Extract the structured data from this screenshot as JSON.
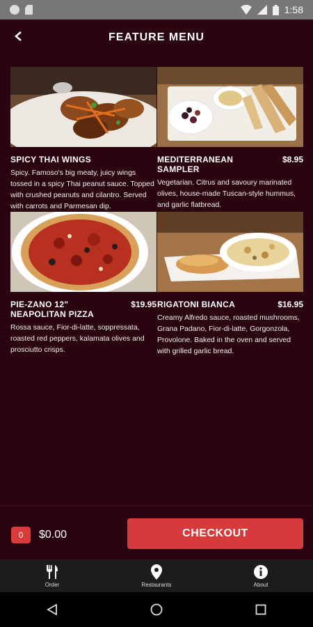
{
  "status": {
    "time": "1:58"
  },
  "header": {
    "title": "FEATURE MENU"
  },
  "items": [
    {
      "name": "SPICY THAI WINGS",
      "price": "",
      "description": "Spicy. Famoso's big meaty, juicy wings tossed in a spicy Thai peanut sauce. Topped with crushed peanuts and cilantro. Served with carrots and Parmesan dip."
    },
    {
      "name": "MEDITERRANEAN SAMPLER",
      "price": "$8.95",
      "description": "Vegetarian. Citrus and savoury marinated olives, house-made Tuscan-style hummus, and garlic flatbread."
    },
    {
      "name": "PIE-ZANO 12\" NEAPOLITAN PIZZA",
      "price": "$19.95",
      "description": "Rossa sauce, Fior-di-latte, soppressata, roasted red peppers, kalamata olives and prosciutto crisps."
    },
    {
      "name": "RIGATONI BIANCA",
      "price": "$16.95",
      "description": "Creamy Alfredo sauce, roasted mushrooms, Grana Padano, Fior-di-latte, Gorgonzola, Provolone. Baked in the oven and served with grilled garlic bread."
    }
  ],
  "cart": {
    "count": "0",
    "total": "$0.00",
    "checkout_label": "CHECKOUT"
  },
  "nav": [
    {
      "label": "Order",
      "icon": "fork-knife-icon"
    },
    {
      "label": "Restaurants",
      "icon": "location-pin-icon"
    },
    {
      "label": "About",
      "icon": "info-icon"
    }
  ],
  "colors": {
    "background": "#2a0410",
    "accent": "#d63a3a"
  }
}
